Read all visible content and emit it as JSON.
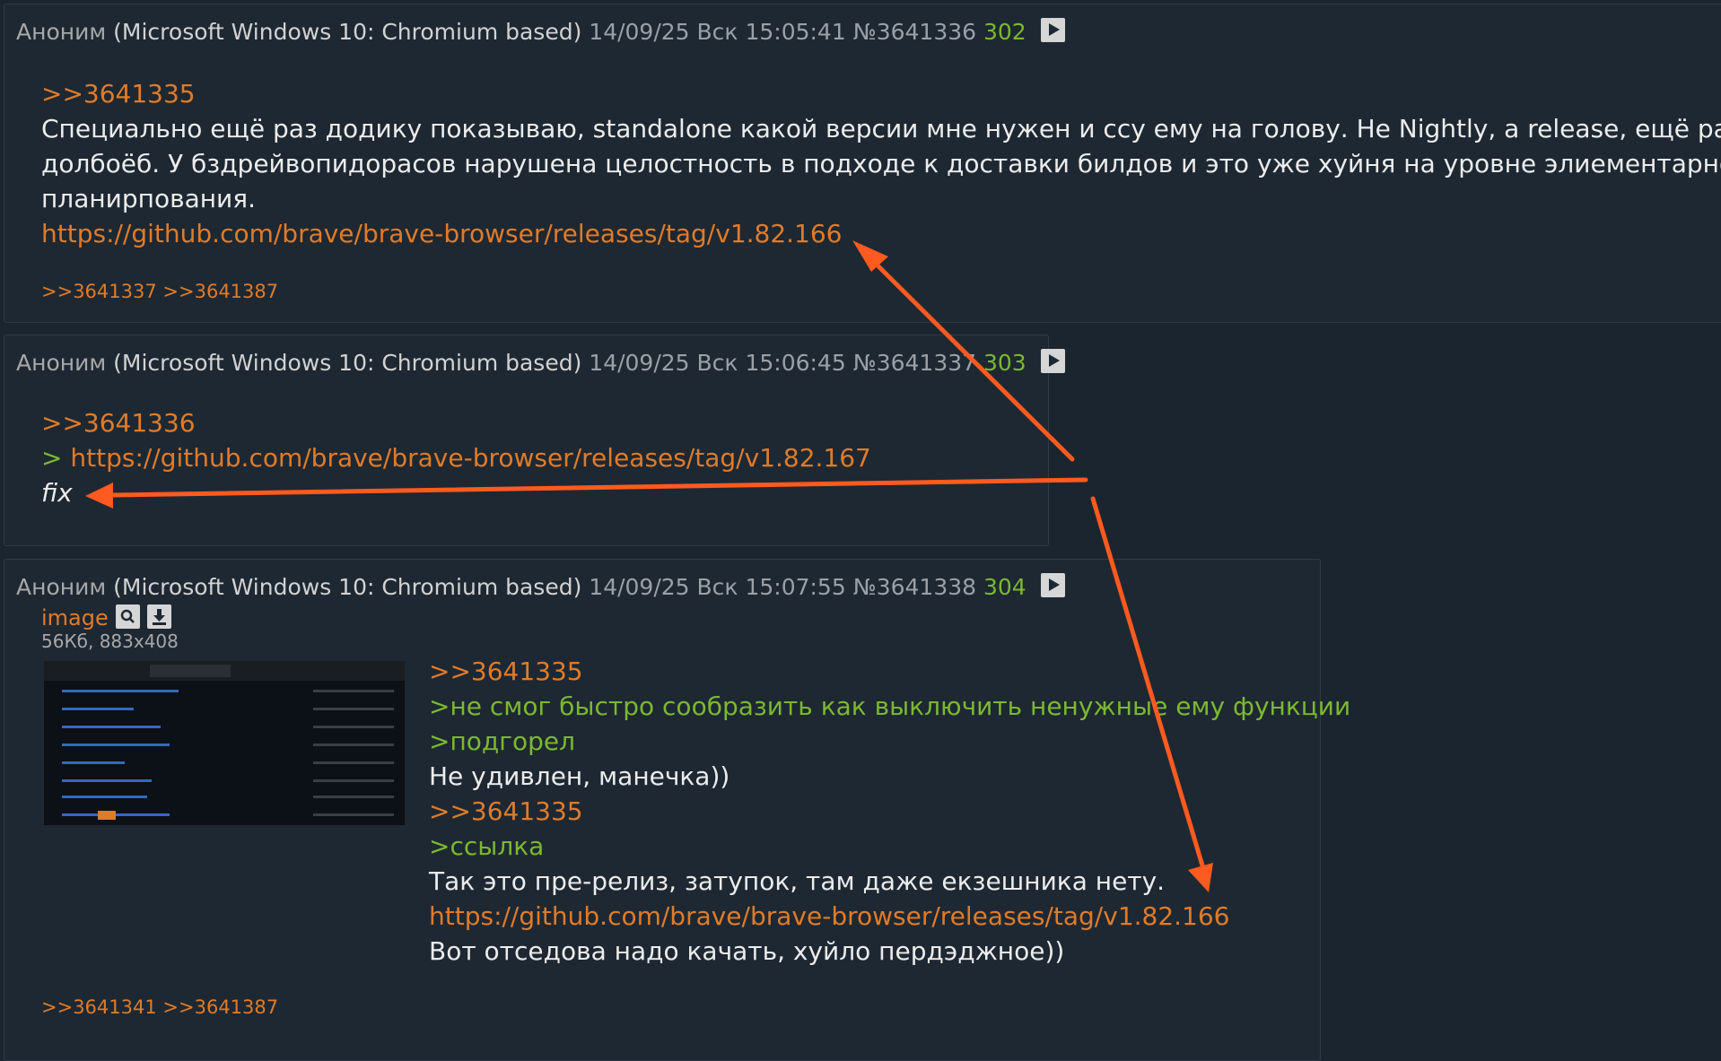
{
  "posts": [
    {
      "author": "Аноним",
      "os": "(Microsoft Windows 10: Chromium based)",
      "date": "14/09/25 Вск 15:05:41",
      "num": "№3641336",
      "index": "302",
      "lines": [
        ">>3641335",
        "Специально ещё раз додику показываю, standalone какой версии мне нужен и ссу ему на голову. Не Nightly, а release, ещё раз",
        "долбоёб. У бздрейвопидорасов нарушена целостность в подходе к доставки билдов и это уже хуйня на уровне элиементарного",
        "планирпования.",
        "https://github.com/brave/brave-browser/releases/tag/v1.82.166"
      ],
      "replies": [
        ">>3641337",
        ">>3641387"
      ]
    },
    {
      "author": "Аноним",
      "os": "(Microsoft Windows 10: Chromium based)",
      "date": "14/09/25 Вск 15:06:45",
      "num": "№3641337",
      "index": "303",
      "lines": [
        ">>3641336",
        "https://github.com/brave/brave-browser/releases/tag/v1.82.167",
        "fix"
      ],
      "quote_prefix": "> "
    },
    {
      "author": "Аноним",
      "os": "(Microsoft Windows 10: Chromium based)",
      "date": "14/09/25 Вск 15:07:55",
      "num": "№3641338",
      "index": "304",
      "image": {
        "name": "image",
        "meta": "56Кб, 883x408"
      },
      "lines": [
        ">>3641335",
        ">не смог быстро сообразить как выключить ненужные ему функции",
        ">подгорел",
        "Не удивлен, манечка))",
        ">>3641335",
        ">ссылка",
        "Так это пре-релиз, затупок, там даже екзешника нету.",
        "https://github.com/brave/brave-browser/releases/tag/v1.82.166",
        "Вот отседова надо качать, хуйло пердэджное))"
      ],
      "replies": [
        ">>3641341",
        ">>3641387"
      ]
    }
  ],
  "colors": {
    "background": "#1b2530",
    "post_bg": "#1d2833",
    "link": "#e07b28",
    "greentext": "#7cb82f",
    "arrow": "#ff5a1f"
  },
  "icons": [
    "play-icon",
    "search-icon",
    "download-icon",
    "arrow-annotation"
  ]
}
